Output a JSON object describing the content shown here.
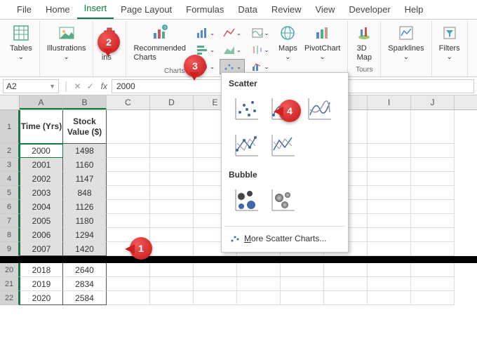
{
  "tabs": [
    "File",
    "Home",
    "Insert",
    "Page Layout",
    "Formulas",
    "Data",
    "Review",
    "View",
    "Developer",
    "Help"
  ],
  "active_tab": 2,
  "ribbon": {
    "tables": "Tables",
    "illustrations": "Illustrations",
    "addins": "Add-\nins",
    "recommended": "Recommended\nCharts",
    "charts_label": "Charts",
    "maps": "Maps",
    "pivotchart": "PivotChart",
    "map3d": "3D\nMap",
    "tours": "Tours",
    "sparklines": "Sparklines",
    "filters": "Filters"
  },
  "namebox": "A2",
  "formula": "2000",
  "cols": [
    "A",
    "B",
    "C",
    "D",
    "E",
    "F",
    "G",
    "H",
    "I",
    "J"
  ],
  "header": {
    "a": "Time (Yrs)",
    "b": "Stock Value ($)"
  },
  "upper_rows": [
    {
      "r": 2,
      "a": "2000",
      "b": "1498",
      "active": true
    },
    {
      "r": 3,
      "a": "2001",
      "b": "1160"
    },
    {
      "r": 4,
      "a": "2002",
      "b": "1147"
    },
    {
      "r": 5,
      "a": "2003",
      "b": "848"
    },
    {
      "r": 6,
      "a": "2004",
      "b": "1126"
    },
    {
      "r": 7,
      "a": "2005",
      "b": "1180"
    },
    {
      "r": 8,
      "a": "2006",
      "b": "1294"
    },
    {
      "r": 9,
      "a": "2007",
      "b": "1420"
    }
  ],
  "lower_rows": [
    {
      "r": 20,
      "a": "2018",
      "b": "2640"
    },
    {
      "r": 21,
      "a": "2019",
      "b": "2834"
    },
    {
      "r": 22,
      "a": "2020",
      "b": "2584"
    }
  ],
  "dropdown": {
    "scatter": "Scatter",
    "bubble": "Bubble",
    "more": "More Scatter Charts..."
  },
  "callouts": {
    "c1": "1",
    "c2": "2",
    "c3": "3",
    "c4": "4"
  }
}
